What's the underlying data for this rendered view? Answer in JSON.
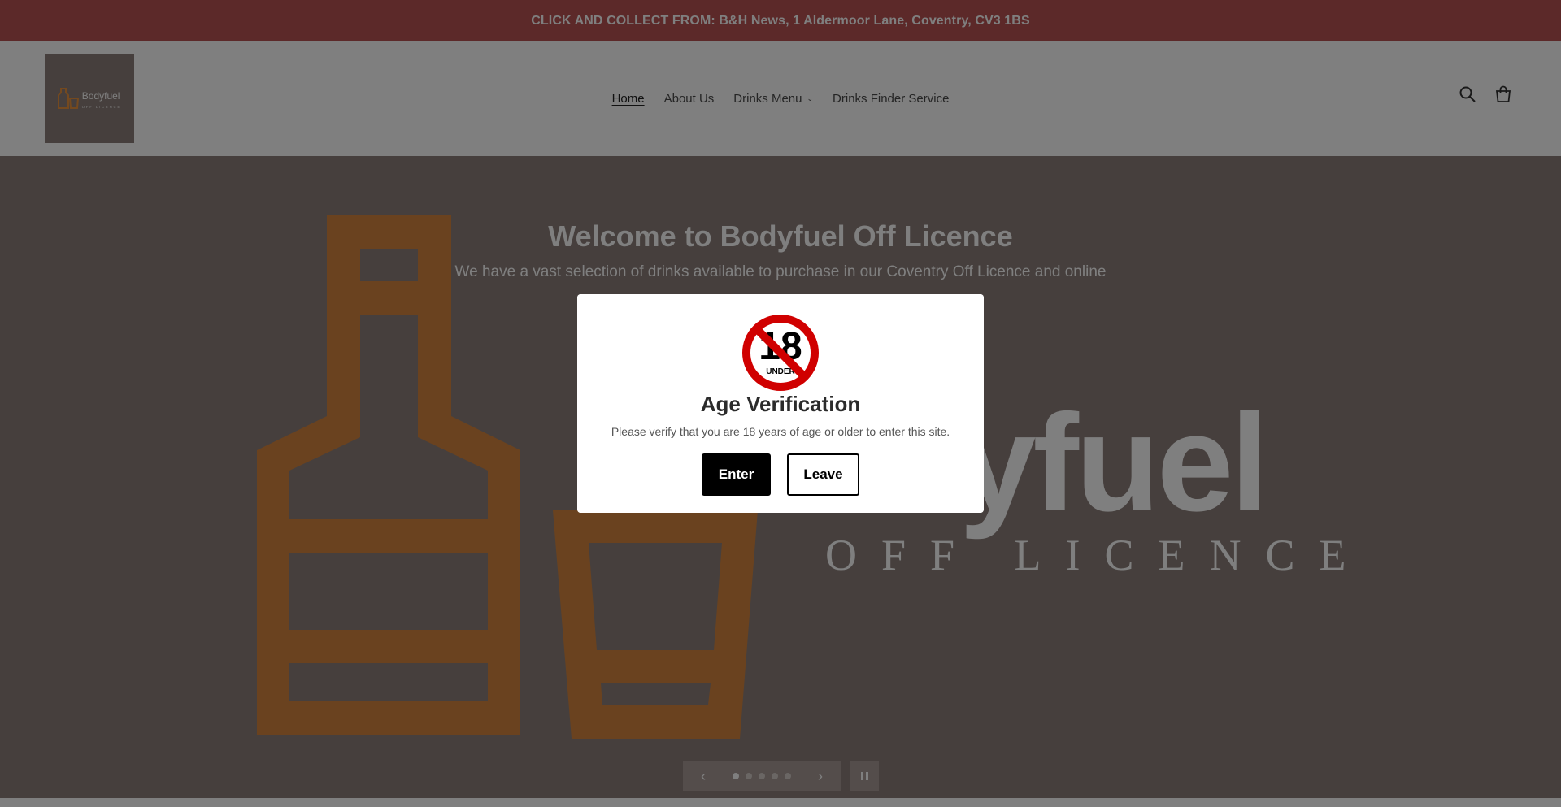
{
  "announcement": {
    "text": "CLICK AND COLLECT FROM: B&H News, 1 Aldermoor Lane, Coventry, CV3 1BS"
  },
  "logo": {
    "name": "Bodyfuel",
    "subtitle": "OFF LICENCE"
  },
  "nav": {
    "items": [
      {
        "label": "Home"
      },
      {
        "label": "About Us"
      },
      {
        "label": "Drinks Menu"
      },
      {
        "label": "Drinks Finder Service"
      }
    ]
  },
  "header_icons": [
    "search-icon",
    "cart-icon"
  ],
  "hero": {
    "title": "Welcome to Bodyfuel Off Licence",
    "subtitle": "We have a vast selection of drinks available to purchase in our Coventry Off Licence and online",
    "brand_word": "dyfuel",
    "brand_tag": "OFF LICENCE",
    "slides": 5,
    "active_slide": 1
  },
  "modal": {
    "badge_number": "18",
    "badge_label": "UNDER",
    "title": "Age Verification",
    "text": "Please verify that you are 18 years of age or older to enter this site.",
    "enter_label": "Enter",
    "leave_label": "Leave"
  },
  "colors": {
    "announcement_bg": "#b85252",
    "hero_bg": "#8c7f7b",
    "art_orange": "#d4843f",
    "badge_red": "#d00000"
  }
}
